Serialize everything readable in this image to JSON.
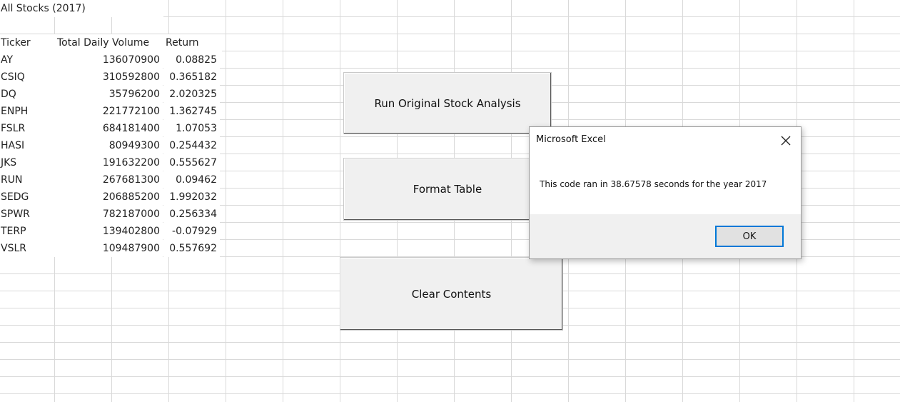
{
  "sheet": {
    "title": "All Stocks (2017)",
    "headers": {
      "ticker": "Ticker",
      "volume": "Total Daily Volume",
      "return": "Return"
    },
    "rows": [
      {
        "ticker": "AY",
        "volume": "136070900",
        "return": "0.08825"
      },
      {
        "ticker": "CSIQ",
        "volume": "310592800",
        "return": "0.365182"
      },
      {
        "ticker": "DQ",
        "volume": "35796200",
        "return": "2.020325"
      },
      {
        "ticker": "ENPH",
        "volume": "221772100",
        "return": "1.362745"
      },
      {
        "ticker": "FSLR",
        "volume": "684181400",
        "return": "1.07053"
      },
      {
        "ticker": "HASI",
        "volume": "80949300",
        "return": "0.254432"
      },
      {
        "ticker": "JKS",
        "volume": "191632200",
        "return": "0.555627"
      },
      {
        "ticker": "RUN",
        "volume": "267681300",
        "return": "0.09462"
      },
      {
        "ticker": "SEDG",
        "volume": "206885200",
        "return": "1.992032"
      },
      {
        "ticker": "SPWR",
        "volume": "782187000",
        "return": "0.256334"
      },
      {
        "ticker": "TERP",
        "volume": "139402800",
        "return": "-0.07929"
      },
      {
        "ticker": "VSLR",
        "volume": "109487900",
        "return": "0.557692"
      }
    ]
  },
  "buttons": {
    "run": "Run Original Stock Analysis",
    "format": "Format Table",
    "clear": "Clear Contents"
  },
  "dialog": {
    "title": "Microsoft Excel",
    "message": "This code ran in 38.67578 seconds for the year 2017",
    "ok_label": "OK",
    "close_icon": "close-icon",
    "accent": "#0078d7"
  }
}
